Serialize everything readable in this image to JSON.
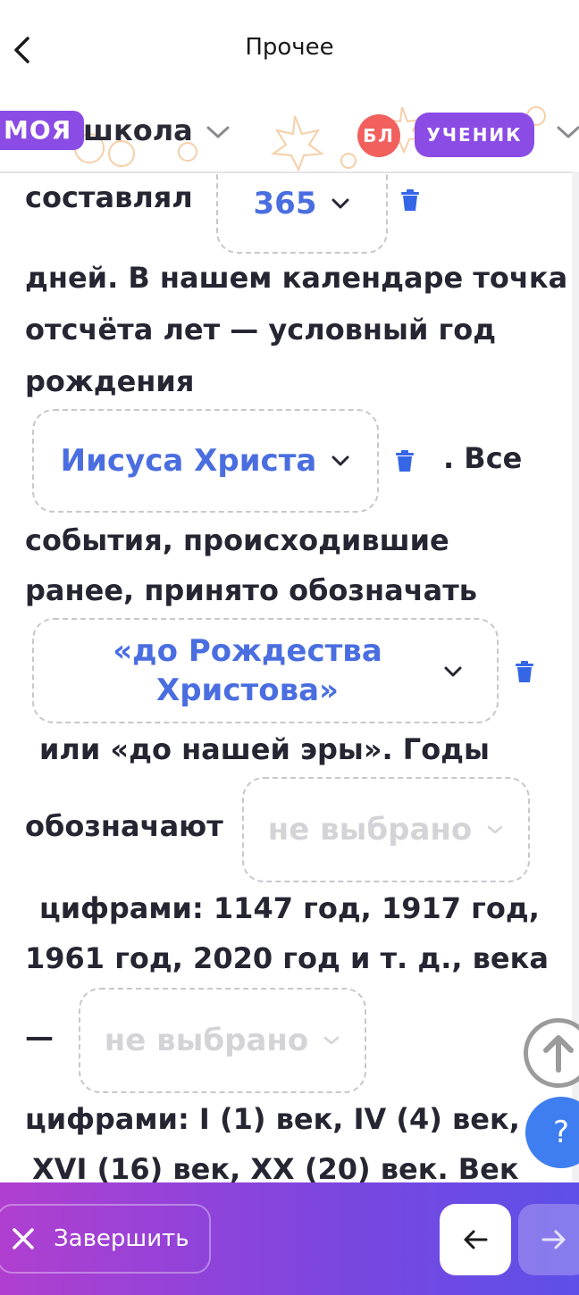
{
  "header": {
    "title": "Прочее"
  },
  "brand": {
    "logo_part1": "МОЯ",
    "logo_part2": "школа",
    "avatar_initials": "БЛ",
    "role_label": "УЧЕНИК"
  },
  "content": {
    "line1": "составлял",
    "line2": "дней. В нашем календаре точка",
    "line3": "отсчёта лет — условный год",
    "line4": "рождения",
    "line5": ". Все",
    "line6": "события, происходившие",
    "line7": "ранее, принято обозначать",
    "line8": "или «до нашей эры».  Годы",
    "line9": "обозначают",
    "line10": "цифрами: 1147 год, 1917 год,",
    "line11": "1961 год, 2020 год и т. д., века",
    "line12": "—",
    "line13": "цифрами: I (1) век, IV (4) век,",
    "line14": "XVI (16) век,  XX (20) век. Век",
    "dropdowns": [
      {
        "value": "365"
      },
      {
        "value": "Иисуса Христа"
      },
      {
        "value": "«до Рождества Христова»"
      },
      {
        "placeholder": "не выбрано"
      },
      {
        "placeholder": "не выбрано"
      }
    ]
  },
  "footer": {
    "finish_label": "Завершить"
  },
  "help": {
    "label": "?"
  },
  "colors": {
    "accent": "#8b4ce6",
    "link": "#4a6ee0",
    "help": "#3f7ef0",
    "avatar": "#f1605d"
  }
}
